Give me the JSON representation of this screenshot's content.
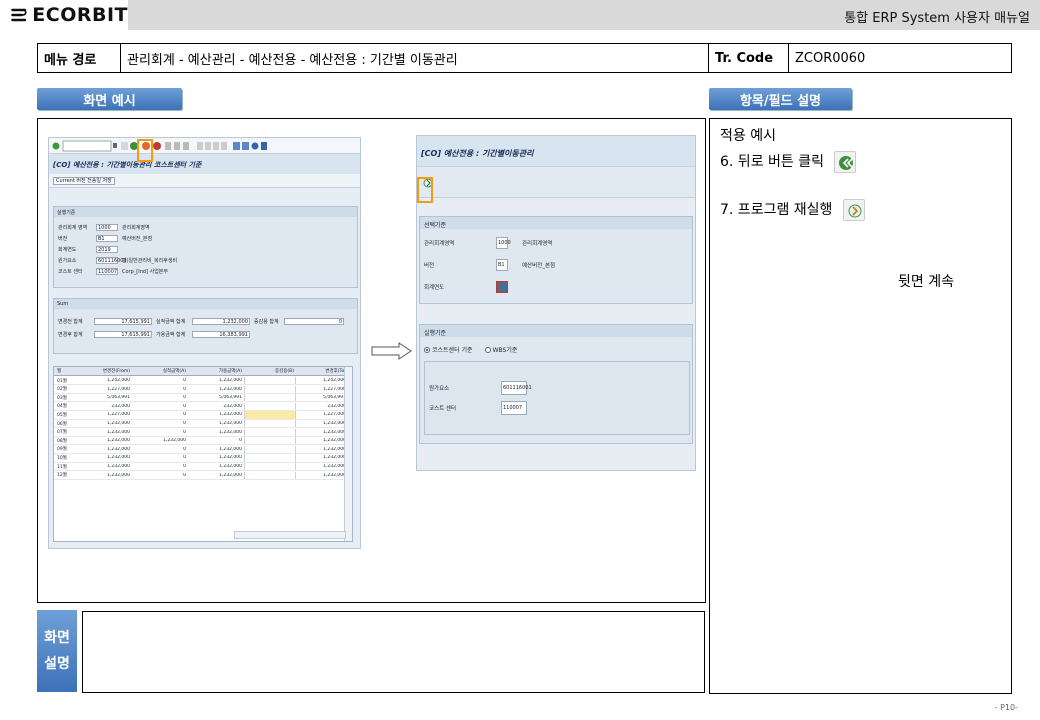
{
  "header": {
    "logo_text": "ECORBIT",
    "manual_title": "통합 ERP System 사용자 매뉴얼"
  },
  "path": {
    "label": "메뉴 경로",
    "value": "관리회계 - 예산관리 - 예산전용 - 예산전용 : 기간별 이동관리",
    "tr_label": "Tr. Code",
    "tr_value": "ZCOR0060"
  },
  "tabs": {
    "screen_example": "화면 예시",
    "field_description": "항목/필드 설명"
  },
  "description": {
    "line1": "적용 예시",
    "line2": "6. 뒤로 버튼 클릭",
    "line3": "7. 프로그램 재실행",
    "continue": "뒷면 계속"
  },
  "screen_desc": {
    "label_top": "화면",
    "label_bottom": "설명",
    "text": ""
  },
  "page_number": "- P10-",
  "sap_left": {
    "title": "[CO] 예산전용 : 기간별이동관리 코스트센터 기준",
    "subtoolbar": "Current 버전 전송일 저장",
    "panel1_title": "실행기준",
    "fields": [
      {
        "label": "관리회계 영역",
        "value": "1000",
        "desc": "관리회계영역"
      },
      {
        "label": "버전",
        "value": "B1",
        "desc": "예산버전_본점"
      },
      {
        "label": "회계연도",
        "value": "2019",
        "desc": ""
      },
      {
        "label": "원가요소",
        "value": "601116001",
        "desc": "판)일반관리비_복리후생비"
      },
      {
        "label": "코스트 센터",
        "value": "110007",
        "desc": "Corp_[Ind] 사업본부"
      }
    ],
    "sum_title": "Sum",
    "sum_rows": [
      {
        "l1": "변경전 합계",
        "v1": "17,615,991",
        "l2": "실적금액 합계",
        "v2": "1,232,000",
        "l3": "증감용 합계",
        "v3": "0"
      },
      {
        "l1": "변경후 합계",
        "v1": "17,615,991",
        "l2": "가용금액 합계",
        "v2": "16,383,991",
        "l3": "",
        "v3": ""
      }
    ],
    "columns": [
      "월",
      "변경전(From)",
      "실적금액(A)",
      "가용금액(A)",
      "증감용(B)",
      "변경후(To)"
    ],
    "rows": [
      [
        "01월",
        "1,242,000",
        "0",
        "1,232,000",
        "",
        "1,242,000"
      ],
      [
        "02월",
        "1,227,000",
        "0",
        "1,232,000",
        "",
        "1,227,000"
      ],
      [
        "03월",
        "5,063,991",
        "0",
        "5,063,991",
        "",
        "5,063,991"
      ],
      [
        "04월",
        "232,000",
        "0",
        "232,000",
        "",
        "232,000"
      ],
      [
        "05월",
        "1,227,000",
        "0",
        "1,232,000",
        "",
        "1,227,000"
      ],
      [
        "06월",
        "1,232,000",
        "0",
        "1,232,000",
        "",
        "1,232,000"
      ],
      [
        "07월",
        "1,232,000",
        "0",
        "1,232,000",
        "",
        "1,232,000"
      ],
      [
        "08월",
        "1,232,000",
        "1,232,000",
        "0",
        "",
        "1,232,000"
      ],
      [
        "09월",
        "1,232,000",
        "0",
        "1,232,000",
        "",
        "1,232,000"
      ],
      [
        "10월",
        "1,232,000",
        "0",
        "1,232,000",
        "",
        "1,232,000"
      ],
      [
        "11월",
        "1,232,000",
        "0",
        "1,232,000",
        "",
        "1,232,000"
      ],
      [
        "12월",
        "1,232,000",
        "0",
        "1,232,000",
        "",
        "1,232,000"
      ]
    ]
  },
  "sap_right": {
    "title": "[CO] 예산전용 : 기간별이동관리",
    "group1_title": "선택기준",
    "group1_fields": [
      {
        "label": "관리회계영역",
        "value": "1000",
        "desc": "관리회계영역"
      },
      {
        "label": "버전",
        "value": "B1",
        "desc": "예산버전_본점"
      },
      {
        "label": "회계연도",
        "value": "",
        "desc": ""
      }
    ],
    "group2_title": "실행기준",
    "radio1": "코스트센터 기준",
    "radio2": "WBS기준",
    "group2_fields": [
      {
        "label": "원가요소",
        "value": "601116001"
      },
      {
        "label": "코스트 센터",
        "value": "110007"
      }
    ]
  },
  "colors": {
    "tab_blue": "#3d72b8",
    "highlight": "#f39c12",
    "header_gray": "#d9d9d9"
  }
}
